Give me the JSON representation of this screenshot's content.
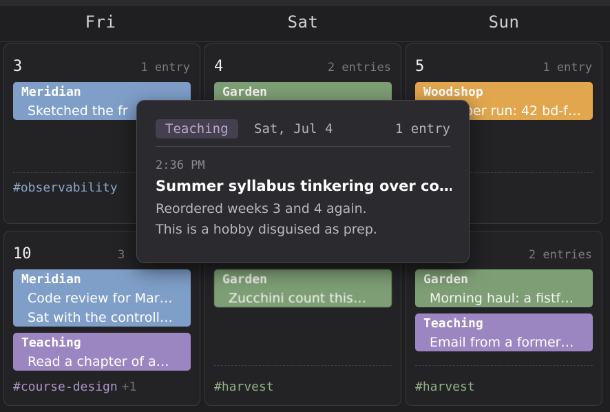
{
  "days": [
    "Fri",
    "Sat",
    "Sun"
  ],
  "row1": {
    "fri": {
      "num": "3",
      "count": "1 entry",
      "entries": [
        {
          "title": "Meridian",
          "lines": [
            "Sketched the fr"
          ]
        }
      ],
      "tag": "#observability"
    },
    "sat": {
      "num": "4",
      "count": "2 entries",
      "entries": [
        {
          "title": "Garden"
        }
      ]
    },
    "sun": {
      "num": "5",
      "count": "1 entry",
      "entries": [
        {
          "title": "Woodshop",
          "lines": [
            "ber run: 42 bd-f…"
          ]
        }
      ]
    }
  },
  "row2": {
    "fri": {
      "num": "10",
      "count": "3",
      "entries": [
        {
          "title": "Meridian",
          "lines": [
            "Code review for Mar…",
            "Sat with the controll…"
          ]
        },
        {
          "title": "Teaching",
          "lines": [
            "Read a chapter of a…"
          ]
        }
      ],
      "tag": "#course-design",
      "tag_extra": "+1"
    },
    "sat": {
      "entries": [
        {
          "title": "Garden",
          "lines": [
            "Zucchini count this…"
          ]
        }
      ],
      "tag": "#harvest"
    },
    "sun": {
      "count": "2 entries",
      "entries": [
        {
          "title": "Garden",
          "lines": [
            "Morning haul: a fistf…"
          ]
        },
        {
          "title": "Teaching",
          "lines": [
            "Email from a former…"
          ]
        }
      ],
      "tag": "#harvest"
    }
  },
  "popover": {
    "category": "Teaching",
    "date": "Sat, Jul 4",
    "count": "1 entry",
    "time": "2:36 PM",
    "title": "Summer syllabus tinkering over co…",
    "lines": [
      "Reordered weeks 3 and 4 again.",
      "This is a hobby disguised as prep."
    ]
  },
  "colors": {
    "Meridian": "#7f9fc9",
    "Garden": "#7e9f76",
    "Woodshop": "#e2a64f",
    "Teaching": "#9b86c1",
    "tag_blue": "#8ea6c9",
    "tag_purple": "#a896c8",
    "tag_green": "#93b08a"
  }
}
